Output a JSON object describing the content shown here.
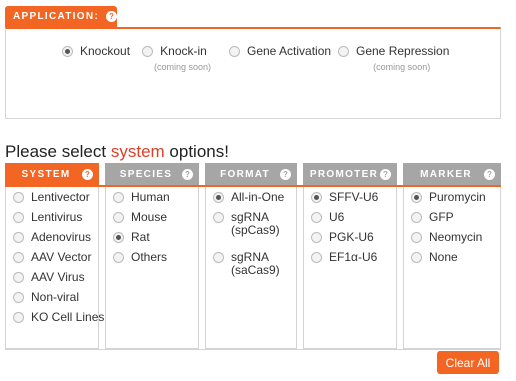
{
  "application": {
    "title": "APPLICATION:",
    "options": [
      {
        "label": "Knockout",
        "sub": "",
        "checked": true
      },
      {
        "label": "Knock-in",
        "sub": "(coming soon)",
        "checked": false
      },
      {
        "label": "Gene Activation",
        "sub": "",
        "checked": false
      },
      {
        "label": "Gene Repression",
        "sub": "(coming soon)",
        "checked": false
      }
    ]
  },
  "heading": {
    "prefix": "Please select ",
    "accent": "system",
    "suffix": " options!"
  },
  "columns": [
    {
      "title": "SYSTEM",
      "active": true,
      "items": [
        {
          "label": "Lentivector",
          "checked": false
        },
        {
          "label": "Lentivirus",
          "checked": false
        },
        {
          "label": "Adenovirus",
          "checked": false
        },
        {
          "label": "AAV Vector",
          "checked": false
        },
        {
          "label": "AAV Virus",
          "checked": false
        },
        {
          "label": "Non-viral",
          "checked": false
        },
        {
          "label": "KO Cell Lines",
          "checked": false
        }
      ]
    },
    {
      "title": "SPECIES",
      "active": false,
      "items": [
        {
          "label": "Human",
          "checked": false
        },
        {
          "label": "Mouse",
          "checked": false
        },
        {
          "label": "Rat",
          "checked": true
        },
        {
          "label": "Others",
          "checked": false
        }
      ]
    },
    {
      "title": "FORMAT",
      "active": false,
      "items": [
        {
          "label": "All-in-One",
          "checked": true
        },
        {
          "label": "sgRNA\n(spCas9)",
          "checked": false
        },
        {
          "label": "sgRNA\n(saCas9)",
          "checked": false
        }
      ]
    },
    {
      "title": "PROMOTER",
      "active": false,
      "items": [
        {
          "label": "SFFV-U6",
          "checked": true
        },
        {
          "label": "U6",
          "checked": false
        },
        {
          "label": "PGK-U6",
          "checked": false
        },
        {
          "label": "EF1α-U6",
          "checked": false
        }
      ]
    },
    {
      "title": "MARKER",
      "active": false,
      "items": [
        {
          "label": "Puromycin",
          "checked": true
        },
        {
          "label": "GFP",
          "checked": false
        },
        {
          "label": "Neomycin",
          "checked": false
        },
        {
          "label": "None",
          "checked": false
        }
      ]
    }
  ],
  "help_glyph": "?",
  "clear_button": "Clear All",
  "accent_color": "#f26522"
}
